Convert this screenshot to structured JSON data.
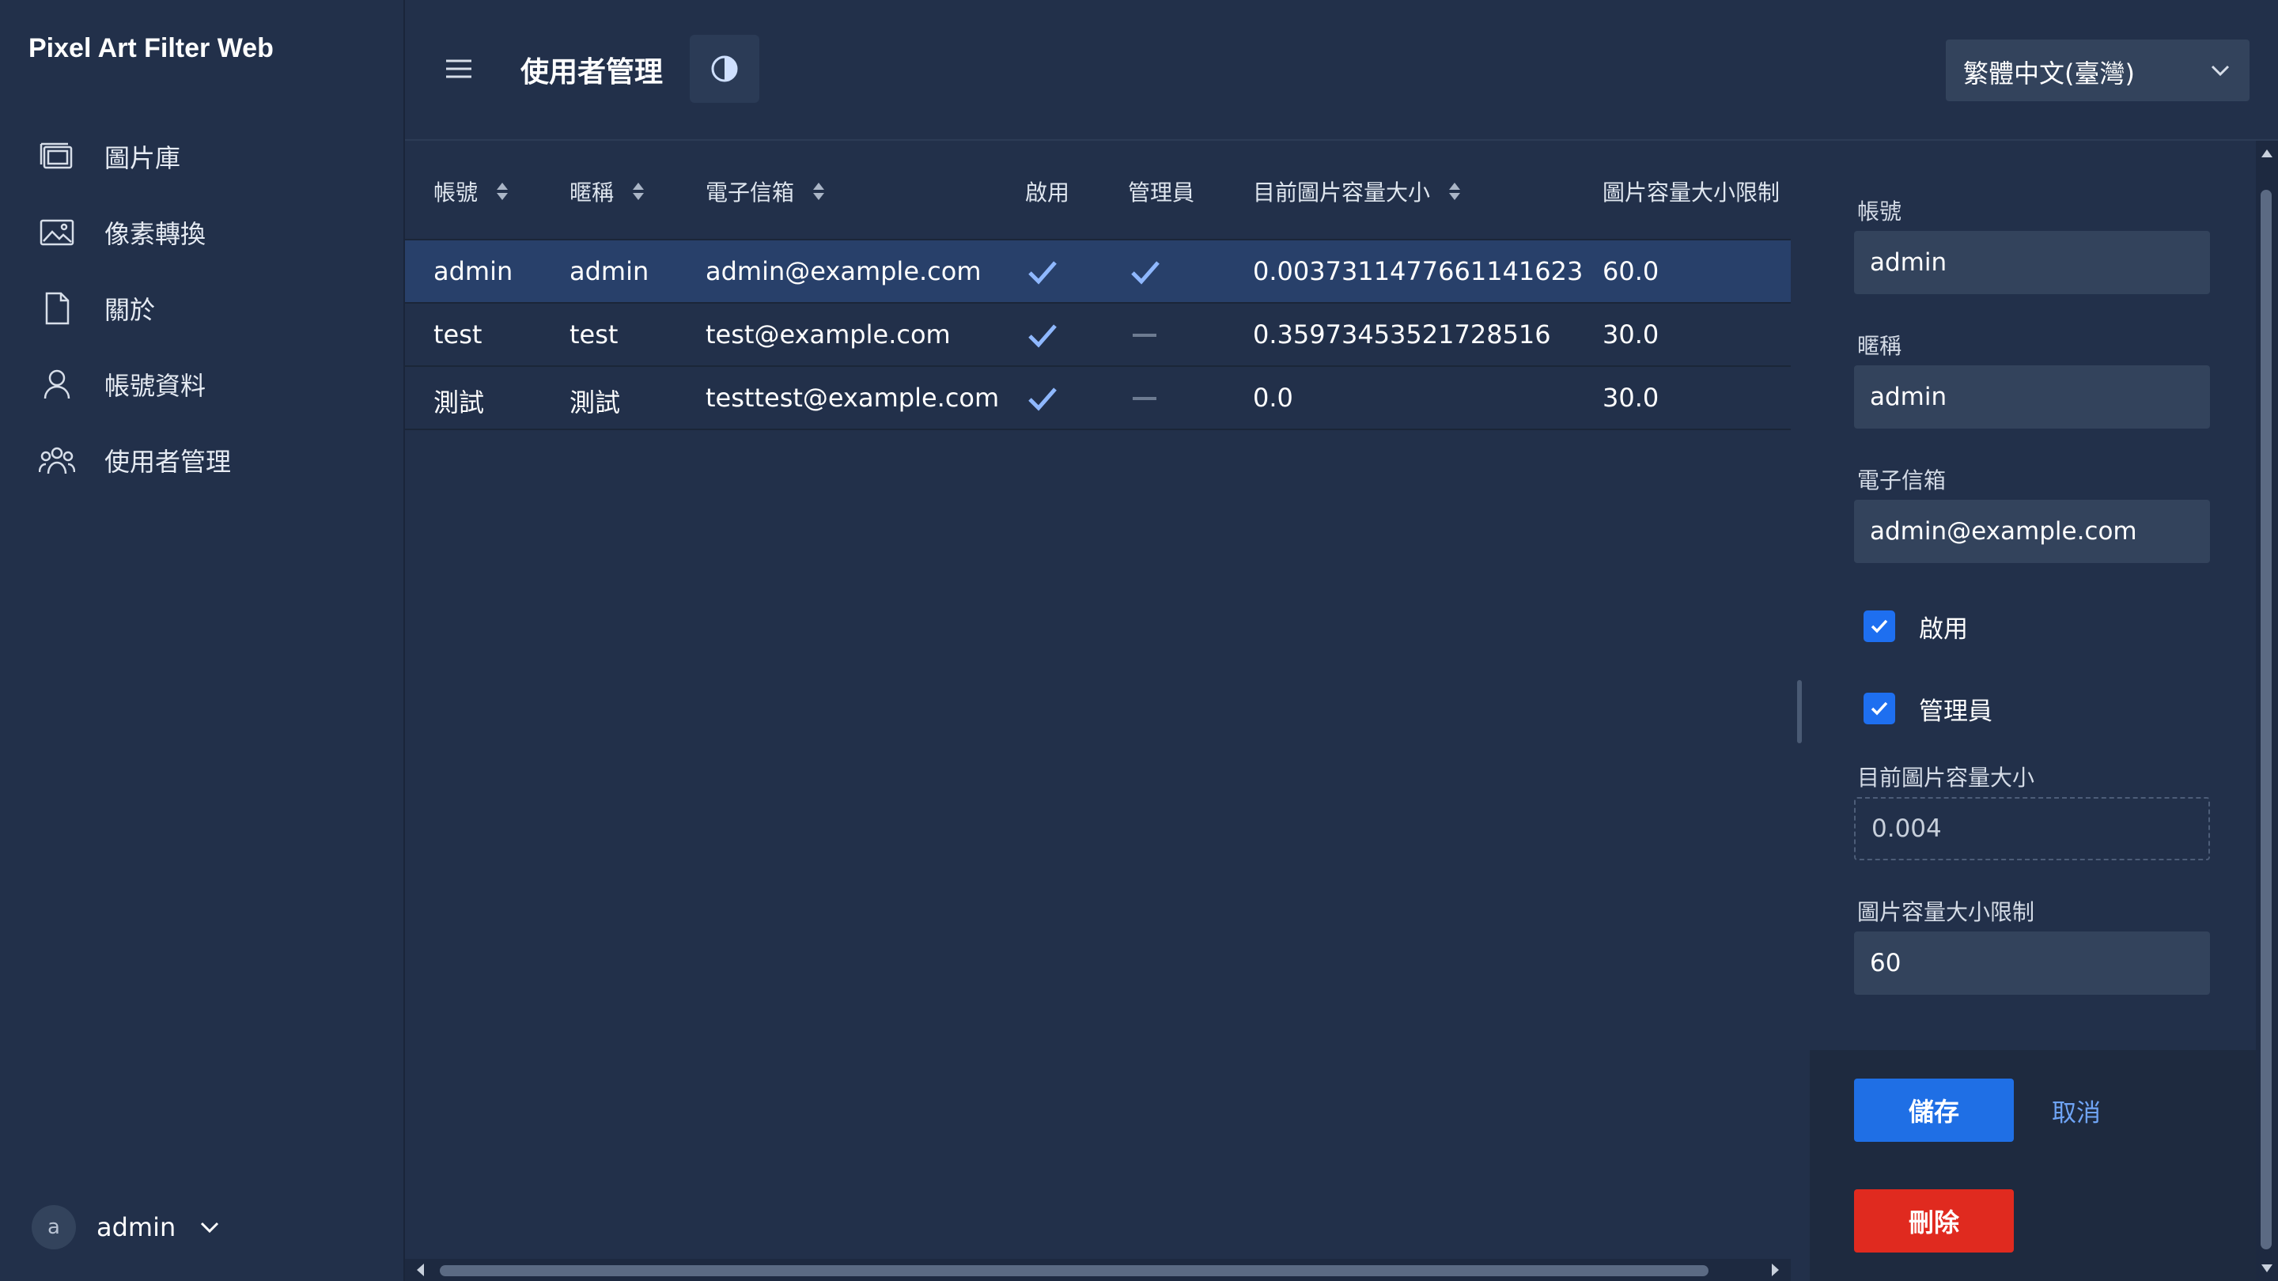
{
  "app": {
    "title": "Pixel Art Filter Web"
  },
  "sidebar": {
    "items": [
      {
        "label": "圖片庫",
        "icon": "gallery-icon"
      },
      {
        "label": "像素轉換",
        "icon": "image-icon"
      },
      {
        "label": "關於",
        "icon": "document-icon"
      },
      {
        "label": "帳號資料",
        "icon": "user-icon"
      },
      {
        "label": "使用者管理",
        "icon": "users-icon"
      }
    ],
    "user": {
      "avatar_letter": "a",
      "name": "admin"
    }
  },
  "header": {
    "title": "使用者管理",
    "language": "繁體中文(臺灣)"
  },
  "table": {
    "columns": [
      "帳號",
      "暱稱",
      "電子信箱",
      "啟用",
      "管理員",
      "目前圖片容量大小",
      "圖片容量大小限制"
    ],
    "rows": [
      {
        "account": "admin",
        "nickname": "admin",
        "email": "admin@example.com",
        "enabled": true,
        "admin": true,
        "usage": "0.0037311477661141623",
        "limit": "60.0",
        "selected": true
      },
      {
        "account": "test",
        "nickname": "test",
        "email": "test@example.com",
        "enabled": true,
        "admin": false,
        "usage": "0.35973453521728516",
        "limit": "30.0",
        "selected": false
      },
      {
        "account": "測試",
        "nickname": "測試",
        "email": "testtest@example.com",
        "enabled": true,
        "admin": false,
        "usage": "0.0",
        "limit": "30.0",
        "selected": false
      }
    ]
  },
  "form": {
    "account_label": "帳號",
    "account_value": "admin",
    "nickname_label": "暱稱",
    "nickname_value": "admin",
    "email_label": "電子信箱",
    "email_value": "admin@example.com",
    "enabled_label": "啟用",
    "enabled_checked": true,
    "admin_label": "管理員",
    "admin_checked": true,
    "usage_label": "目前圖片容量大小",
    "usage_value": "0.004",
    "limit_label": "圖片容量大小限制",
    "limit_value": "60",
    "save_label": "儲存",
    "cancel_label": "取消",
    "delete_label": "刪除"
  },
  "colors": {
    "background": "#22304a",
    "selected_row": "#28406a",
    "accent": "#1f6fe5",
    "danger": "#e02a1f",
    "check": "#8fb8ff"
  }
}
